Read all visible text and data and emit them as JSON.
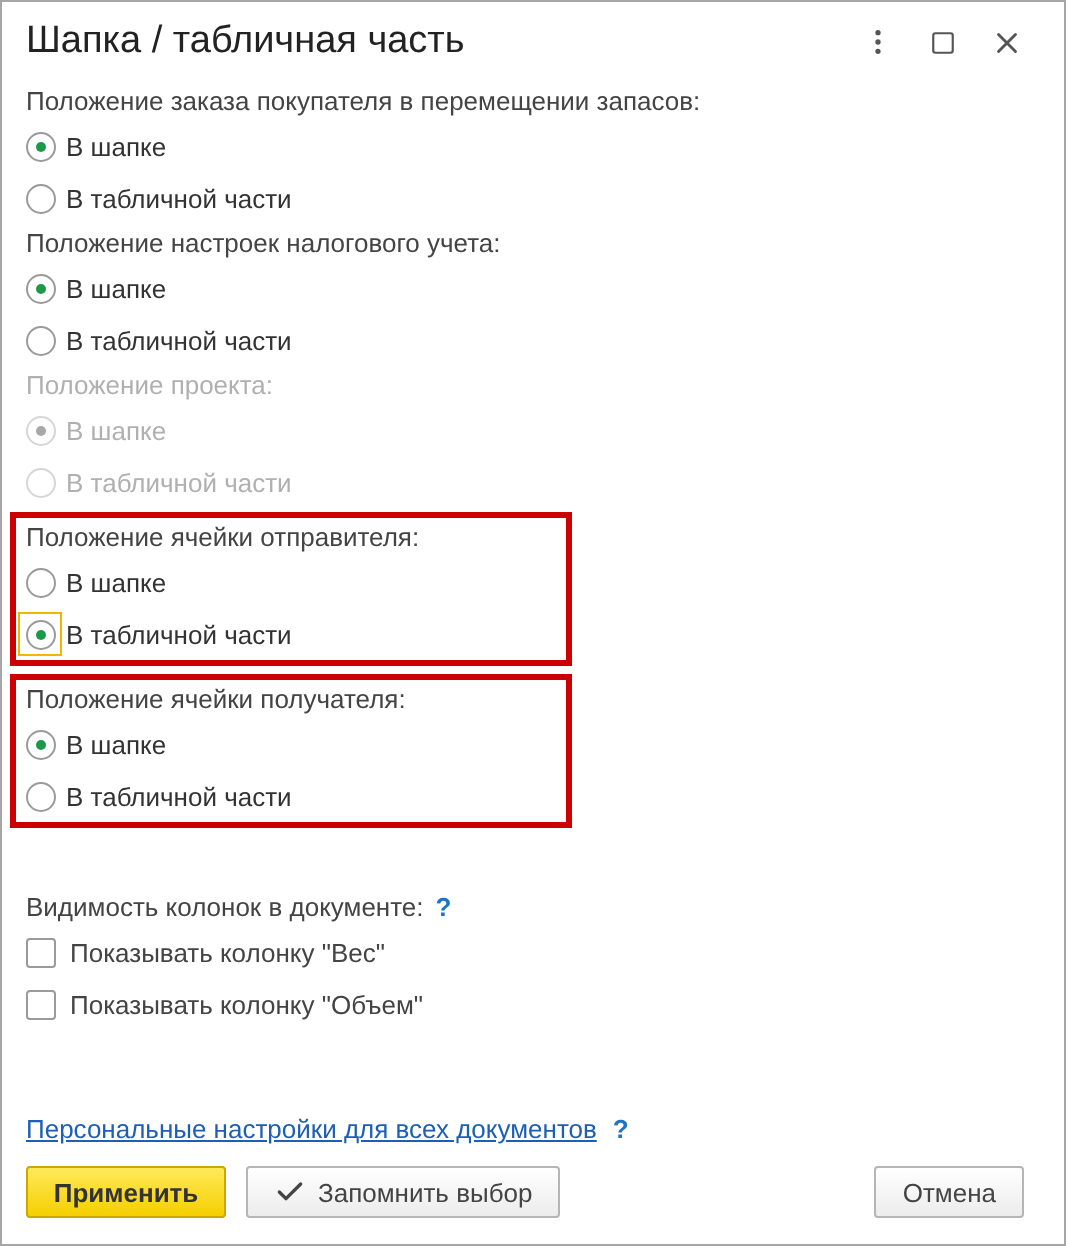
{
  "window": {
    "title": "Шапка / табличная часть"
  },
  "groups": [
    {
      "label": "Положение заказа покупателя в перемещении запасов:",
      "disabled": false,
      "highlighted": false,
      "options": [
        {
          "label": "В шапке",
          "selected": true,
          "focused": false
        },
        {
          "label": "В табличной части",
          "selected": false,
          "focused": false
        }
      ]
    },
    {
      "label": "Положение настроек налогового учета:",
      "disabled": false,
      "highlighted": false,
      "options": [
        {
          "label": "В шапке",
          "selected": true,
          "focused": false
        },
        {
          "label": "В табличной части",
          "selected": false,
          "focused": false
        }
      ]
    },
    {
      "label": "Положение проекта:",
      "disabled": true,
      "highlighted": false,
      "options": [
        {
          "label": "В шапке",
          "selected": true,
          "focused": false
        },
        {
          "label": "В табличной части",
          "selected": false,
          "focused": false
        }
      ]
    },
    {
      "label": "Положение ячейки отправителя:",
      "disabled": false,
      "highlighted": true,
      "options": [
        {
          "label": "В шапке",
          "selected": false,
          "focused": false
        },
        {
          "label": "В табличной части",
          "selected": true,
          "focused": true
        }
      ]
    },
    {
      "label": "Положение ячейки получателя:",
      "disabled": false,
      "highlighted": true,
      "options": [
        {
          "label": "В шапке",
          "selected": true,
          "focused": false
        },
        {
          "label": "В табличной части",
          "selected": false,
          "focused": false
        }
      ]
    }
  ],
  "visibility": {
    "label": "Видимость колонок в документе:",
    "help": "?",
    "checkboxes": [
      {
        "label": "Показывать колонку \"Вес\"",
        "checked": false
      },
      {
        "label": "Показывать колонку \"Объем\"",
        "checked": false
      }
    ]
  },
  "link": {
    "label": "Персональные настройки для всех документов",
    "help": "?"
  },
  "buttons": [
    {
      "label": "Применить",
      "kind": "primary"
    },
    {
      "label": "Запомнить выбор",
      "kind": "check"
    },
    {
      "label": "Отмена",
      "kind": "plain"
    }
  ]
}
